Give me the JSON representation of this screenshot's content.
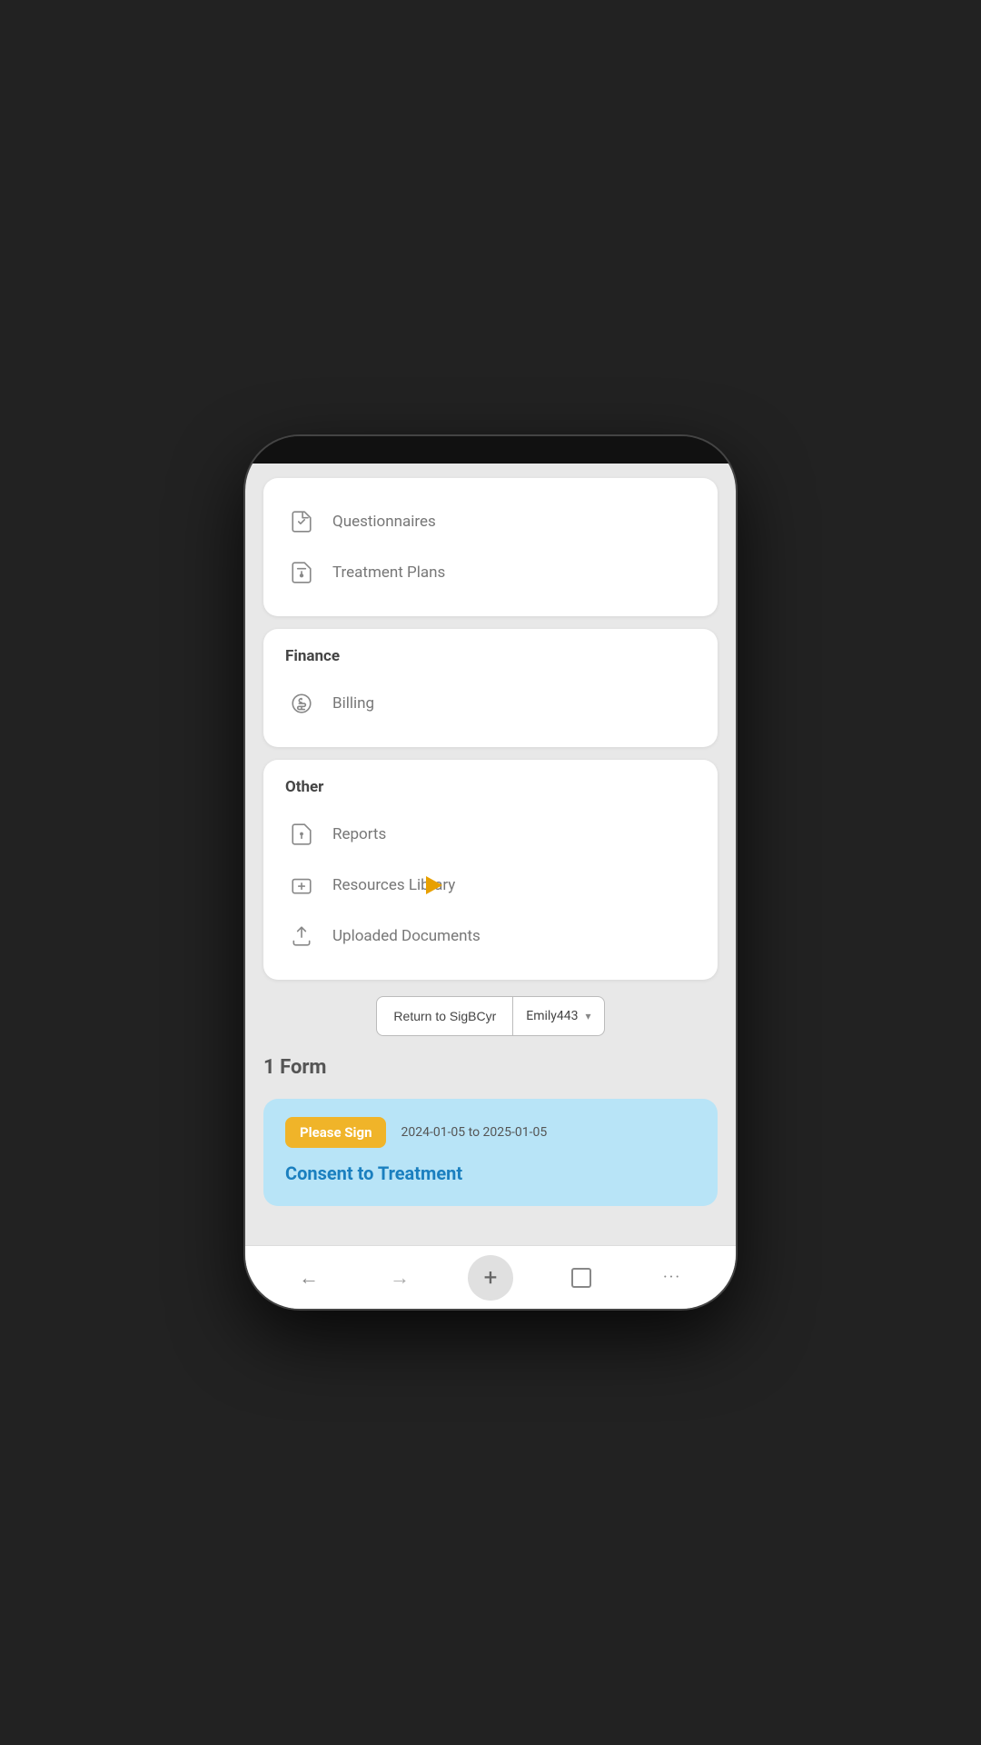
{
  "menu": {
    "section1": {
      "items": [
        {
          "label": "Questionnaires",
          "icon": "questionnaires"
        },
        {
          "label": "Treatment Plans",
          "icon": "treatment-plans"
        }
      ]
    },
    "section2": {
      "title": "Finance",
      "items": [
        {
          "label": "Billing",
          "icon": "billing"
        }
      ]
    },
    "section3": {
      "title": "Other",
      "items": [
        {
          "label": "Reports",
          "icon": "reports"
        },
        {
          "label": "Resources Library",
          "icon": "resources"
        },
        {
          "label": "Uploaded Documents",
          "icon": "documents"
        }
      ]
    }
  },
  "actions": {
    "return_button": "Return to SigBCyr",
    "user_dropdown": "Emily443"
  },
  "forms": {
    "count_label": "1 Form",
    "items": [
      {
        "badge": "Please Sign",
        "date_range": "2024-01-05 to 2025-01-05",
        "title": "Consent to Treatment"
      }
    ]
  },
  "bottom_nav": {
    "back": "←",
    "forward": "→",
    "add": "+",
    "window": "▢",
    "more": "···"
  }
}
